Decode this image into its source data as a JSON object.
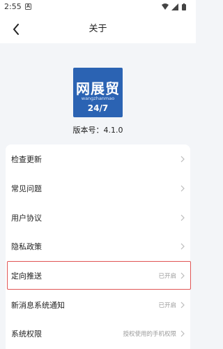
{
  "status_bar": {
    "time": "2:55",
    "notification_icon": "notification-icon",
    "icons": [
      "wifi-icon",
      "signal-icon",
      "battery-icon"
    ]
  },
  "header": {
    "title": "关于",
    "back_icon": "back-arrow-icon"
  },
  "logo": {
    "mark": "网展贸",
    "sub": "wangzhanmao",
    "tagline": "24/7"
  },
  "version_text": "版本号：4.1.0",
  "settings": {
    "items": [
      {
        "label": "检查更新",
        "value": ""
      },
      {
        "label": "常见问题",
        "value": ""
      },
      {
        "label": "用户协议",
        "value": ""
      },
      {
        "label": "隐私政策",
        "value": ""
      },
      {
        "label": "定向推送",
        "value": "已开启"
      },
      {
        "label": "新消息系统通知",
        "value": "已开启"
      },
      {
        "label": "系统权限",
        "value": "授权使用的手机权限"
      }
    ]
  },
  "colors": {
    "brand_blue": "#2b63b3",
    "background": "#f3f5f8",
    "highlight_red": "#e05555"
  }
}
